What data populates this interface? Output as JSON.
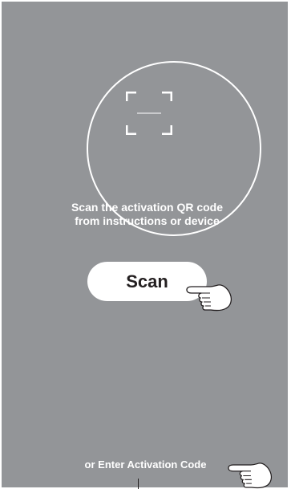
{
  "scan_area": {
    "icon": "qr-scan-frame-icon"
  },
  "instruction": {
    "line1": "Scan the activation QR code",
    "line2": "from instructions or device"
  },
  "scan_button": {
    "label": "Scan"
  },
  "enter_code": {
    "label": "or Enter Activation Code"
  },
  "pointer_icon": "pointing-hand-icon",
  "colors": {
    "background": "#939598",
    "foreground": "#ffffff",
    "button_text": "#231f20"
  }
}
